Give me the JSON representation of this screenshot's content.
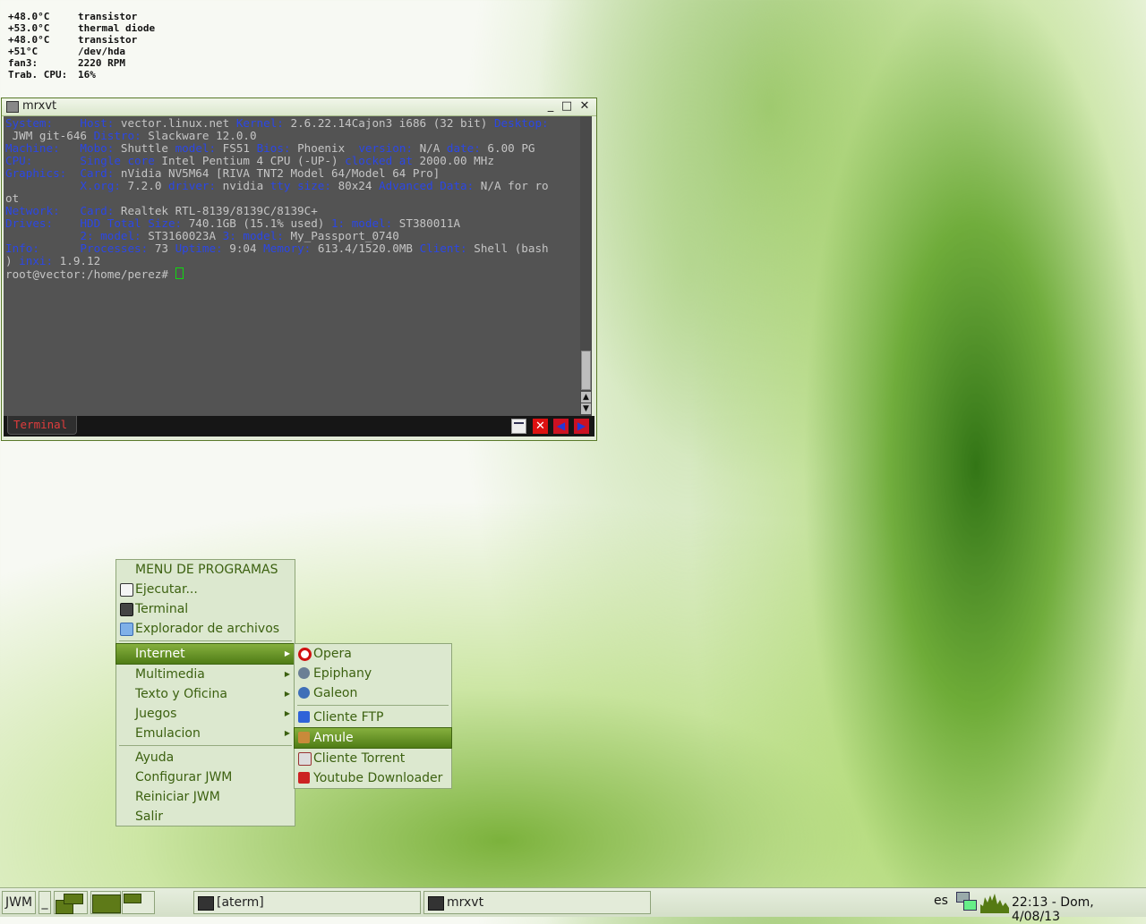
{
  "sensors": [
    {
      "k": "+48.0°C",
      "v": "transistor"
    },
    {
      "k": "+53.0°C",
      "v": "thermal diode"
    },
    {
      "k": "+48.0°C",
      "v": "transistor"
    },
    {
      "k": "+51°C",
      "v": "/dev/hda"
    },
    {
      "k": "fan3:",
      "v": "2220 RPM"
    },
    {
      "k": "Trab. CPU:",
      "v": "16%"
    }
  ],
  "window": {
    "title": "mrxvt",
    "minimize": "_",
    "maximize": "□",
    "close": "✕",
    "tab_label": "Terminal",
    "prompt": "root@vector:/home/perez# "
  },
  "terminal_lines": [
    [
      [
        "b",
        "System:    Host: "
      ],
      [
        "g",
        "vector.linux.net "
      ],
      [
        "b",
        "Kernel: "
      ],
      [
        "g",
        "2.6.22.14Cajon3 i686 (32 bit) "
      ],
      [
        "b",
        "Desktop:"
      ]
    ],
    [
      [
        "g",
        " JWM git-646 "
      ],
      [
        "b",
        "Distro: "
      ],
      [
        "g",
        "Slackware 12.0.0"
      ]
    ],
    [
      [
        "b",
        "Machine:   Mobo: "
      ],
      [
        "g",
        "Shuttle "
      ],
      [
        "b",
        "model: "
      ],
      [
        "g",
        "FS51 "
      ],
      [
        "b",
        "Bios: "
      ],
      [
        "g",
        "Phoenix  "
      ],
      [
        "b",
        "version: "
      ],
      [
        "g",
        "N/A "
      ],
      [
        "b",
        "date: "
      ],
      [
        "g",
        "6.00 PG"
      ]
    ],
    [
      [
        "b",
        "CPU:       Single core "
      ],
      [
        "g",
        "Intel Pentium 4 CPU (-UP-) "
      ],
      [
        "b",
        "clocked at "
      ],
      [
        "g",
        "2000.00 MHz"
      ]
    ],
    [
      [
        "b",
        "Graphics:  Card: "
      ],
      [
        "g",
        "nVidia NV5M64 [RIVA TNT2 Model 64/Model 64 Pro]"
      ]
    ],
    [
      [
        "b",
        "           X.org: "
      ],
      [
        "g",
        "7.2.0 "
      ],
      [
        "b",
        "driver: "
      ],
      [
        "g",
        "nvidia "
      ],
      [
        "b",
        "tty size: "
      ],
      [
        "g",
        "80x24 "
      ],
      [
        "b",
        "Advanced Data: "
      ],
      [
        "g",
        "N/A for ro"
      ]
    ],
    [
      [
        "g",
        "ot"
      ]
    ],
    [
      [
        "b",
        "Network:   Card: "
      ],
      [
        "g",
        "Realtek RTL-8139/8139C/8139C+"
      ]
    ],
    [
      [
        "b",
        "Drives:    HDD Total Size: "
      ],
      [
        "g",
        "740.1GB (15.1% used) "
      ],
      [
        "b",
        "1: model: "
      ],
      [
        "g",
        "ST380011A"
      ]
    ],
    [
      [
        "b",
        "           2: model: "
      ],
      [
        "g",
        "ST3160023A "
      ],
      [
        "b",
        "3: model: "
      ],
      [
        "g",
        "My_Passport_0740"
      ]
    ],
    [
      [
        "b",
        "Info:      Processes: "
      ],
      [
        "g",
        "73 "
      ],
      [
        "b",
        "Uptime: "
      ],
      [
        "g",
        "9:04 "
      ],
      [
        "b",
        "Memory: "
      ],
      [
        "g",
        "613.4/1520.0MB "
      ],
      [
        "b",
        "Client: "
      ],
      [
        "g",
        "Shell (bash"
      ]
    ],
    [
      [
        "g",
        ") "
      ],
      [
        "b",
        "inxi: "
      ],
      [
        "g",
        "1.9.12"
      ]
    ]
  ],
  "main_menu": {
    "header": "MENU DE PROGRAMAS",
    "top_items": [
      {
        "label": "Ejecutar...",
        "icon": "run-icon"
      },
      {
        "label": "Terminal",
        "icon": "terminal-icon"
      },
      {
        "label": "Explorador de archivos",
        "icon": "folder-icon"
      }
    ],
    "submenus": [
      "Internet",
      "Multimedia",
      "Texto y Oficina",
      "Juegos",
      "Emulacion"
    ],
    "bottom_items": [
      "Ayuda",
      "Configurar JWM",
      "Reiniciar JWM",
      "Salir"
    ]
  },
  "internet_menu": {
    "group1": [
      {
        "label": "Opera",
        "icon": "opera-icon"
      },
      {
        "label": "Epiphany",
        "icon": "epiphany-icon"
      },
      {
        "label": "Galeon",
        "icon": "galeon-icon"
      }
    ],
    "group2": [
      {
        "label": "Cliente FTP",
        "icon": "ftp-icon"
      },
      {
        "label": "Amule",
        "icon": "amule-icon"
      },
      {
        "label": "Cliente Torrent",
        "icon": "torrent-icon"
      },
      {
        "label": "Youtube Downloader",
        "icon": "youtube-icon"
      }
    ],
    "selected": "Amule"
  },
  "taskbar": {
    "start": "JWM",
    "show_desktop": "_",
    "tasks": [
      "[aterm]",
      "mrxvt"
    ],
    "lang": "es",
    "clock": "22:13 - Dom,  4/08/13"
  },
  "colors": {
    "accent": "#4f7c16",
    "menu_bg": "#dce8cf",
    "term_bg": "#535353",
    "term_label": "#2b47e6"
  }
}
